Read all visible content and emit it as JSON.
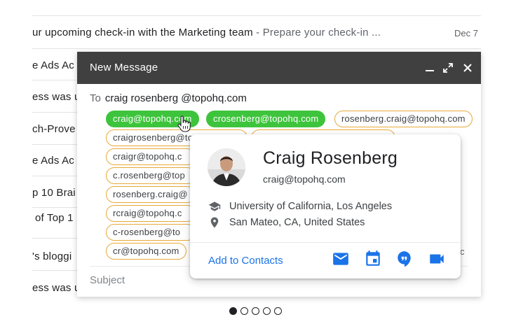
{
  "inbox": {
    "rows": [
      {
        "text": "ur upcoming check-in with the Marketing team",
        "snippet": " - Prepare your check-in ...",
        "date": "Dec 7"
      },
      {
        "text": "e Ads Ac",
        "snippet": "",
        "date": ""
      },
      {
        "text": "ess was u",
        "snippet": "",
        "date": ""
      },
      {
        "text": "ch-Prove",
        "snippet": "",
        "date": ""
      },
      {
        "text": "e Ads Ac",
        "snippet": "",
        "date": ""
      },
      {
        "text": "p 10 Brai",
        "snippet": "",
        "date": ""
      },
      {
        "text": "of Top 1",
        "snippet": "",
        "date": ""
      },
      {
        "text": "'s bloggi",
        "snippet": "",
        "date": ""
      },
      {
        "text": "ess was u",
        "snippet": "",
        "date": ""
      }
    ]
  },
  "compose": {
    "title": "New Message",
    "to_label": "To",
    "to_value": "craig rosenberg @topohq.com",
    "subject_placeholder": "Subject",
    "cc_tail": "c",
    "chips": [
      "craig@topohq.com",
      "crosenberg@topohq.com",
      "rosenberg.craig@topohq.com",
      "craigrosenberg@topohq.com",
      "craigr@topohq.com",
      "c.rosenberg@topohq.com",
      "rosenberg.craig@topohq.com",
      "rcraig@topohq.com",
      "c-rosenberg@topohq.com",
      "cr@topohq.com"
    ],
    "chip_visible": [
      "craig@topohq.com",
      "crosenberg@topohq.com",
      "rosenberg.craig@topohq.com",
      "craigrosenberg@to",
      "craigr@topohq.c",
      "c.rosenberg@top",
      "rosenberg.craig@",
      "rcraig@topohq.c",
      "c-rosenberg@to",
      "cr@topohq.com"
    ]
  },
  "card": {
    "name": "Craig Rosenberg",
    "email": "craig@topohq.com",
    "education": "University of California, Los Angeles",
    "location": "San Mateo, CA, United States",
    "add_label": "Add to Contacts",
    "icons": [
      "mail-icon",
      "calendar-icon",
      "hangouts-icon",
      "video-call-icon"
    ]
  },
  "pagination": {
    "count": 5,
    "active": 0
  },
  "colors": {
    "header_bg": "#404040",
    "chip_selected": "#3dc43c",
    "chip_outline": "#e8a93a",
    "link_blue": "#1a73e8",
    "action_icon": "#1a73e8"
  }
}
